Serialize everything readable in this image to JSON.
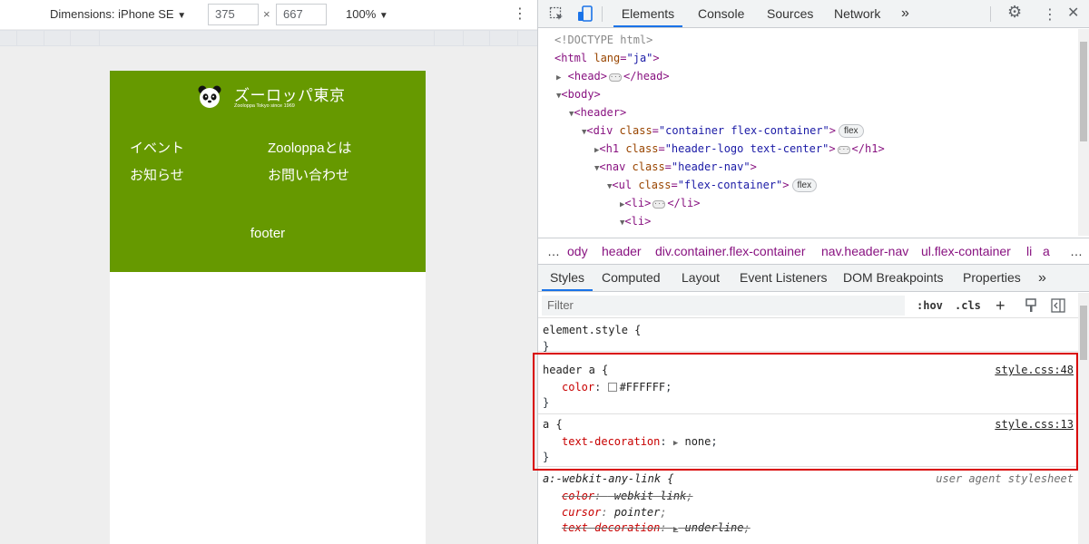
{
  "device_toolbar": {
    "dimensions_label": "Dimensions: iPhone SE",
    "width_value": "375",
    "times_symbol": "×",
    "height_value": "667",
    "zoom_label": "100%"
  },
  "site": {
    "logo_title": "ズーロッパ東京",
    "logo_subtitle": "Zooloppa Tokyo since 1969",
    "nav": {
      "item1": "イベント",
      "item2": "Zooloppaとは",
      "item3": "お知らせ",
      "item4": "お問い合わせ"
    },
    "footer": "footer",
    "header_color": "#669900"
  },
  "devtools": {
    "tabs": {
      "elements": "Elements",
      "console": "Console",
      "sources": "Sources",
      "network": "Network",
      "more": "»"
    },
    "tree": {
      "doctype": "<!DOCTYPE html>",
      "html_open": "<html ",
      "html_attr": "lang",
      "html_val": "\"ja\"",
      "head": "<head>",
      "head_close": "</head>",
      "body": "<body>",
      "header": "<header>",
      "div_open": "<div ",
      "div_attr": "class",
      "div_val": "\"container flex-container\"",
      "flex_badge": "flex",
      "h1_open": "<h1 ",
      "h1_attr": "class",
      "h1_val": "\"header-logo text-center\"",
      "h1_close": "</h1>",
      "nav_open": "<nav ",
      "nav_attr": "class",
      "nav_val": "\"header-nav\"",
      "ul_open": "<ul ",
      "ul_attr": "class",
      "ul_val": "\"flex-container\"",
      "li1": "<li>",
      "li1_close": "</li>",
      "li2": "<li>"
    },
    "breadcrumbs": {
      "more": "…",
      "body": "ody",
      "header": "header",
      "div": "div.container.flex-container",
      "nav": "nav.header-nav",
      "ul": "ul.flex-container",
      "li": "li",
      "a": "a",
      "end": "…"
    },
    "styles_tabs": {
      "styles": "Styles",
      "computed": "Computed",
      "layout": "Layout",
      "event_listeners": "Event Listeners",
      "dom_breakpoints": "DOM Breakpoints",
      "properties": "Properties",
      "more": "»"
    },
    "filter": {
      "placeholder": "Filter",
      "hov": ":hov",
      "cls": ".cls",
      "plus": "+"
    },
    "rules": {
      "element_style": "element.style {",
      "element_close": "}",
      "r1_selector": "header a {",
      "r1_source": "style.css:48",
      "r1_prop": "color",
      "r1_value": "#FFFFFF",
      "r1_close": "}",
      "r2_selector": "a {",
      "r2_source": "style.css:13",
      "r2_prop": "text-decoration",
      "r2_value": "none",
      "r2_close": "}",
      "r3_selector": "a:-webkit-any-link {",
      "r3_source": "user agent stylesheet",
      "r3_p1": "color",
      "r3_v1": "-webkit-link",
      "r3_p2": "cursor",
      "r3_v2": "pointer",
      "r3_p3": "text-decoration",
      "r3_v3": "underline"
    },
    "highlight_color": "#d90000"
  }
}
